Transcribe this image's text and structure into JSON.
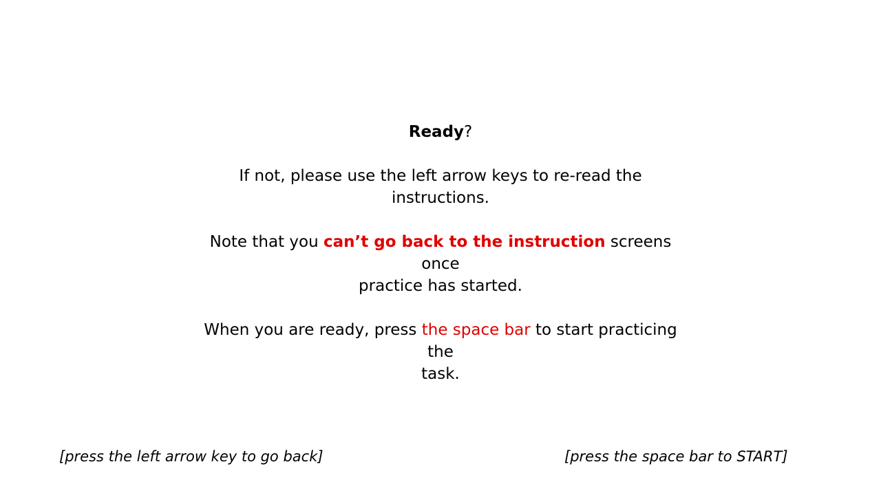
{
  "heading": {
    "word": "Ready",
    "punct": "?"
  },
  "instruction_1": "If not, please use the left arrow keys to re-read the instructions.",
  "note": {
    "before": "Note that you ",
    "highlight": "can’t go back to the instruction",
    "after_line1": " screens once",
    "line2": "practice has started."
  },
  "ready": {
    "before": "When you are ready, press ",
    "highlight": "the space bar",
    "after_line1": " to start practicing the",
    "line2": "task."
  },
  "footer": {
    "back": "[press the left arrow key to go back]",
    "start": "[press the space bar to START]"
  },
  "colors": {
    "accent": "#e00000",
    "text": "#000000",
    "background": "#ffffff"
  }
}
